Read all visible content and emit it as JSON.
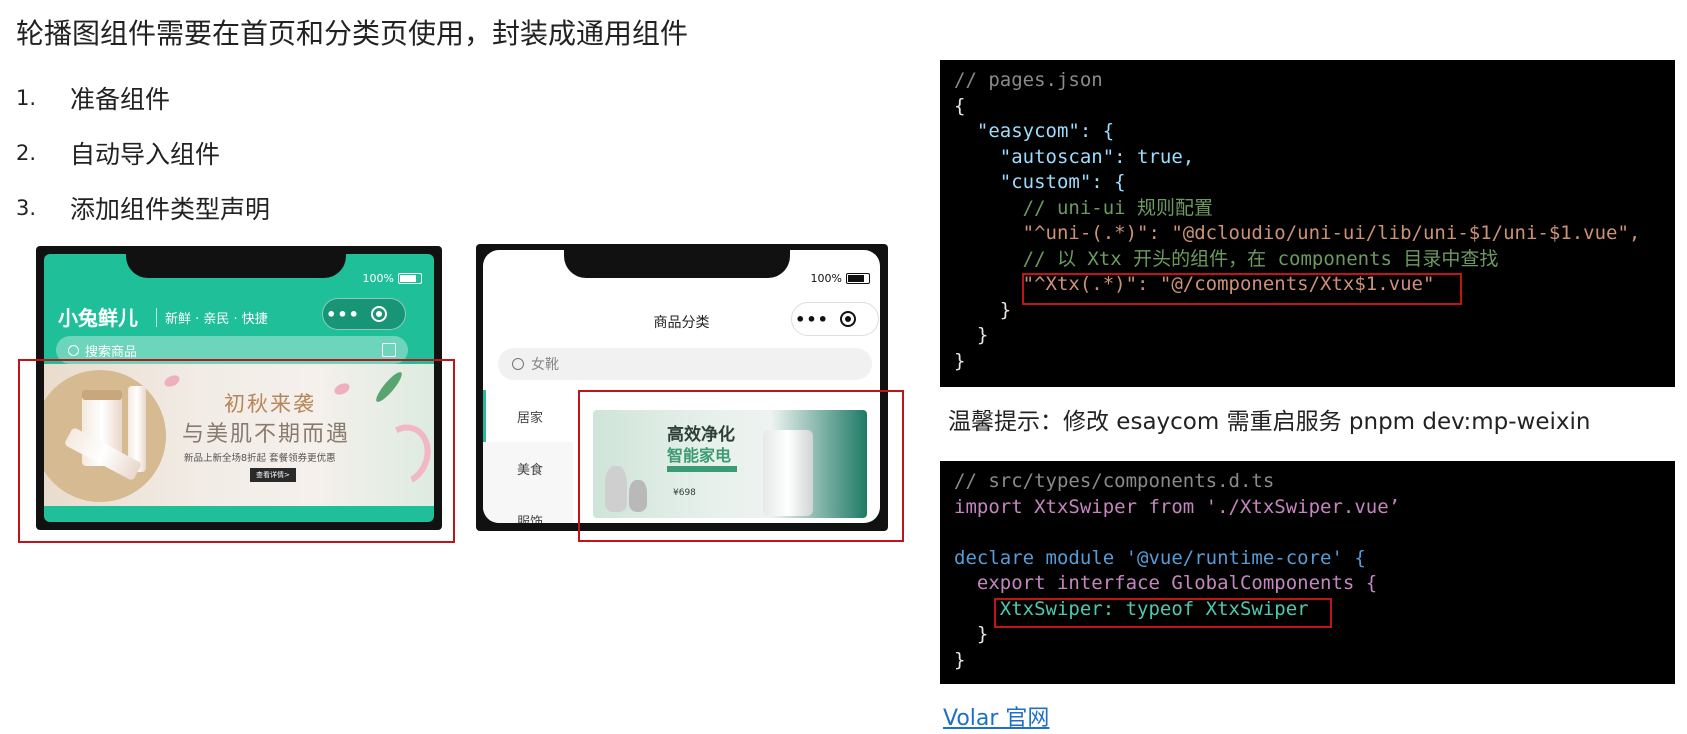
{
  "title": "轮播图组件需要在首页和分类页使用，封装成通用组件",
  "steps": [
    {
      "num": "1.",
      "text": "准备组件"
    },
    {
      "num": "2.",
      "text": "自动导入组件"
    },
    {
      "num": "3.",
      "text": "添加组件类型声明"
    }
  ],
  "phone1": {
    "battery": "100%",
    "brand": "小兔鲜儿",
    "slogan": "新鲜 · 亲民 · 快捷",
    "search_placeholder": "搜索商品",
    "banner": {
      "headline1": "初秋来袭",
      "headline2": "与美肌不期而遇",
      "subline": "新品上新全场8折起 套餐领券更优惠",
      "button": "查看详情>"
    }
  },
  "phone2": {
    "battery": "100%",
    "title": "商品分类",
    "search_placeholder": "女靴",
    "categories": [
      "居家",
      "美食",
      "服饰"
    ],
    "banner": {
      "headline1": "高效净化",
      "headline2": "智能家电",
      "price": "¥698"
    }
  },
  "code_pages_json": [
    "// pages.json",
    "{",
    "  \"easycom\": {",
    "    \"autoscan\": true,",
    "    \"custom\": {",
    "      // uni-ui 规则配置",
    "      \"^uni-(.*)\": \"@dcloudio/uni-ui/lib/uni-$1/uni-$1.vue\",",
    "      // 以 Xtx 开头的组件，在 components 目录中查找",
    "      \"^Xtx(.*)\": \"@/components/Xtx$1.vue\"",
    "    }",
    "  }",
    "}"
  ],
  "tip": "温馨提示：修改 esaycom 需重启服务  pnpm dev:mp-weixin",
  "code_components_d_ts": [
    "// src/types/components.d.ts",
    "import XtxSwiper from './XtxSwiper.vue’",
    "",
    "declare module '@vue/runtime-core' {",
    "  export interface GlobalComponents {",
    "    XtxSwiper: typeof XtxSwiper",
    "  }",
    "}"
  ],
  "link": "Volar 官网",
  "colors": {
    "highlight_box": "#c0141b",
    "code_bg": "#000000",
    "brand_green": "#1fbf99",
    "link": "#1e6fc8"
  }
}
